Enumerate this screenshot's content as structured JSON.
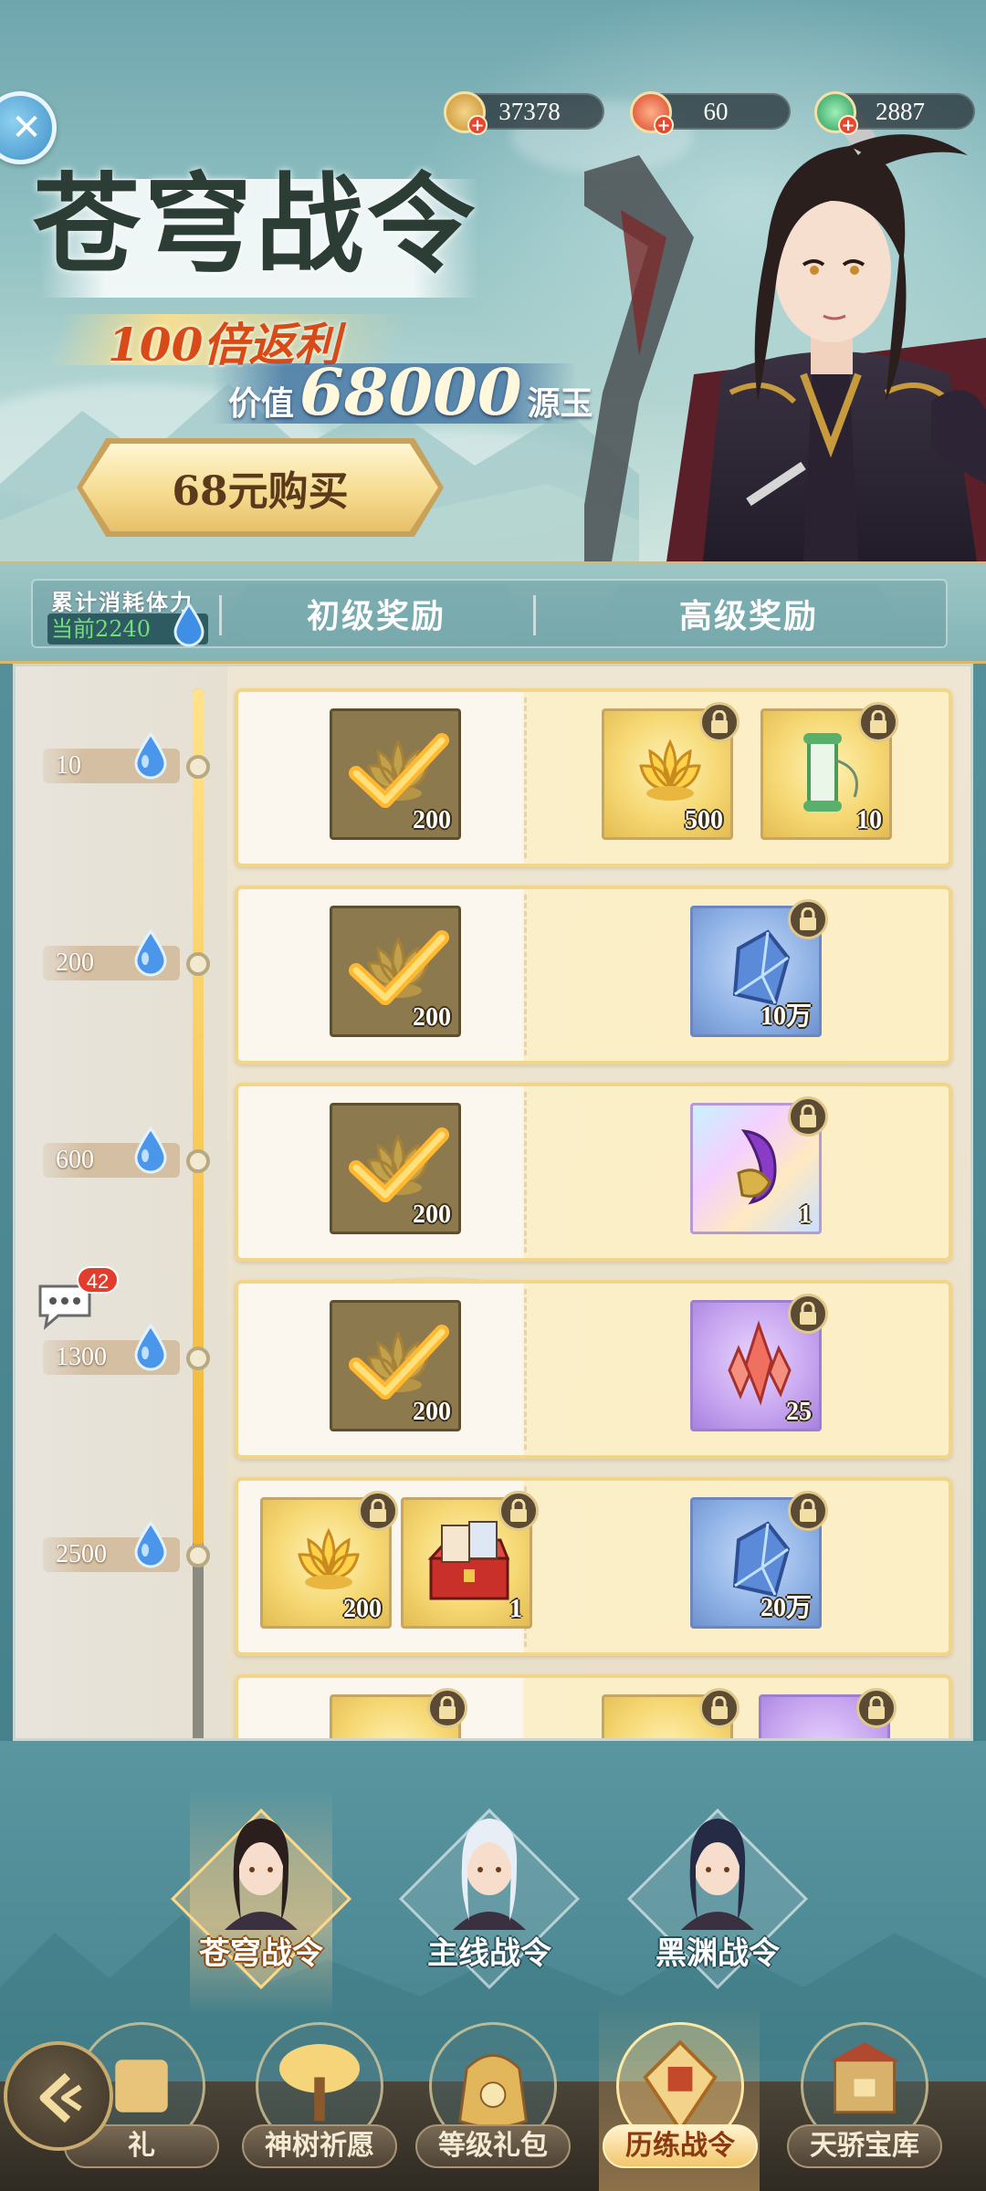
{
  "currencies": [
    {
      "name": "coin",
      "value": "37378",
      "color": "#d8a64a"
    },
    {
      "name": "red-gem",
      "value": "60",
      "color": "#e2502c"
    },
    {
      "name": "jade",
      "value": "2887",
      "color": "#3cae6a"
    }
  ],
  "banner": {
    "title": "苍穹战令",
    "rebate": "100倍返利",
    "value_prefix": "价值",
    "value_amount": "68000",
    "value_suffix": "源玉",
    "buy_label": "68元购买"
  },
  "header": {
    "stamina_label": "累计消耗体力",
    "stamina_current": "当前2240",
    "basic_tier": "初级奖励",
    "premium_tier": "高级奖励"
  },
  "chat_badge": "42",
  "rows": [
    {
      "threshold": "10",
      "basic": [
        {
          "type": "gold-lotus",
          "count": "200",
          "claimed": true
        }
      ],
      "premium": [
        {
          "type": "gold-lotus",
          "count": "500",
          "locked": true,
          "bg": "gold"
        },
        {
          "type": "scroll",
          "count": "10",
          "locked": true,
          "bg": "gold"
        }
      ]
    },
    {
      "threshold": "200",
      "basic": [
        {
          "type": "gold-lotus",
          "count": "200",
          "claimed": true
        }
      ],
      "premium": [
        {
          "type": "blue-crystal",
          "count": "10万",
          "locked": true,
          "bg": "blue"
        }
      ]
    },
    {
      "threshold": "600",
      "basic": [
        {
          "type": "gold-lotus",
          "count": "200",
          "claimed": true
        }
      ],
      "premium": [
        {
          "type": "purple-ornament",
          "count": "1",
          "locked": true,
          "bg": "holo"
        }
      ]
    },
    {
      "threshold": "1300",
      "basic": [
        {
          "type": "gold-lotus",
          "count": "200",
          "claimed": true
        }
      ],
      "premium": [
        {
          "type": "red-crystal",
          "count": "25",
          "locked": true,
          "bg": "purple"
        }
      ]
    },
    {
      "threshold": "2500",
      "basic": [
        {
          "type": "gold-lotus",
          "count": "200",
          "locked": true,
          "bg": "gold"
        },
        {
          "type": "treasure-box",
          "count": "1",
          "locked": true,
          "bg": "gold"
        }
      ],
      "premium": [
        {
          "type": "blue-crystal",
          "count": "20万",
          "locked": true,
          "bg": "blue"
        }
      ]
    }
  ],
  "pass_tabs": [
    {
      "label": "苍穹战令",
      "active": true
    },
    {
      "label": "主线战令",
      "active": false
    },
    {
      "label": "黑渊战令",
      "active": false
    }
  ],
  "nav": [
    {
      "label": "礼",
      "active": false
    },
    {
      "label": "神树祈愿",
      "active": false
    },
    {
      "label": "等级礼包",
      "active": false
    },
    {
      "label": "历练战令",
      "active": true
    },
    {
      "label": "天骄宝库",
      "active": false
    }
  ]
}
